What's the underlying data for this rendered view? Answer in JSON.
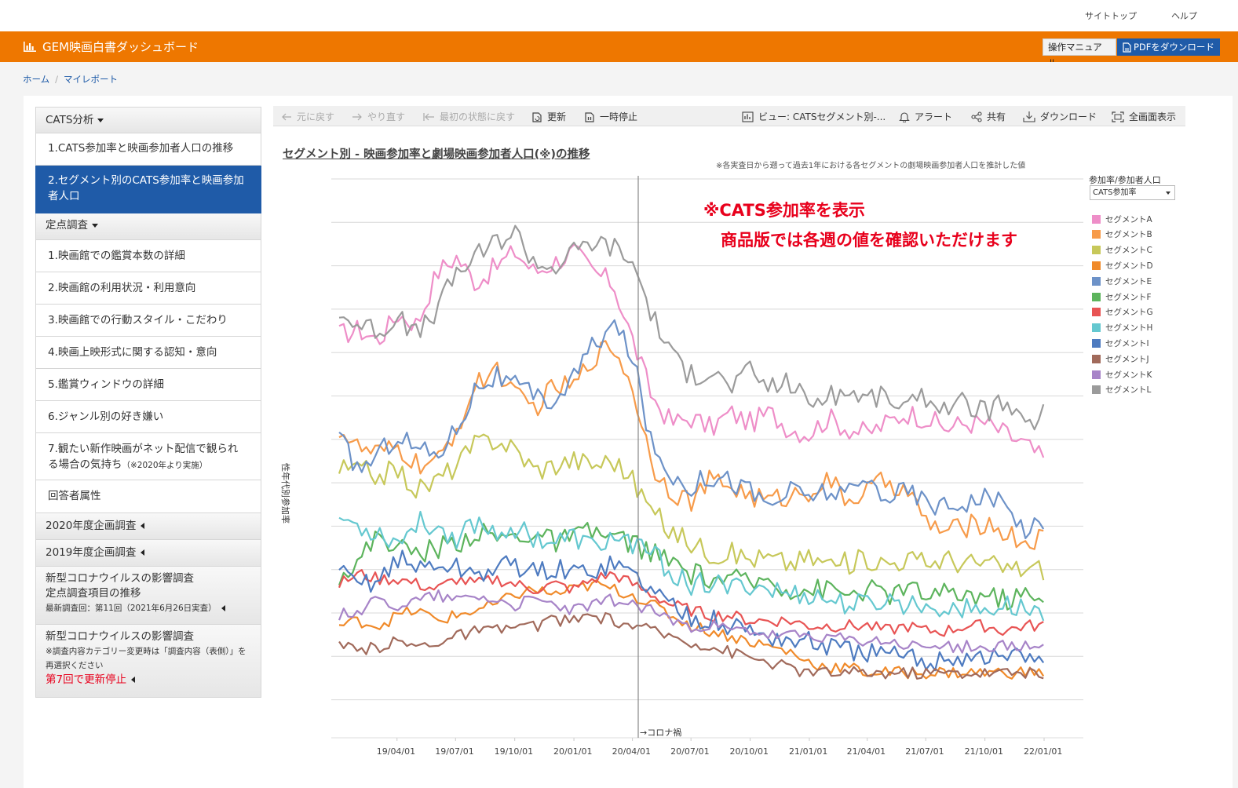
{
  "topnav": {
    "site_top": "サイトトップ",
    "help": "ヘルプ"
  },
  "header": {
    "brand_icon": "bar-chart-icon",
    "title": "GEM映画白書ダッシュボード",
    "manual_button": "操作マニュアル",
    "pdf_button": "PDFをダウンロード",
    "brand_color": "#ee7700"
  },
  "breadcrumb": [
    "ホーム",
    "マイレポート"
  ],
  "sidebar": {
    "cats_section": "CATS分析",
    "cats_items": [
      "1.CATS参加率と映画参加者人口の推移",
      "2.セグメント別のCATS参加率と映画参加者人口"
    ],
    "fixed_section": "定点調査",
    "fixed_items": [
      "1.映画館での鑑賞本数の詳細",
      "2.映画館の利用状況・利用意向",
      "3.映画館での行動スタイル・こだわり",
      "4.映画上映形式に関する認知・意向",
      "5.鑑賞ウィンドウの詳細",
      "6.ジャンル別の好き嫌い",
      "7.観たい新作映画がネット配信で観られる場合の気持ち"
    ],
    "fixed_item7_note": "（※2020年より実施）",
    "respondent_item": "回答者属性",
    "section_2020": "2020年度企画調査",
    "section_2019": "2019年度企画調査",
    "corona1_title1": "新型コロナウイルスの影響調査",
    "corona1_title2": "定点調査項目の推移",
    "corona1_note": "最新調査回：第11回（2021年6月26日実査）",
    "corona2_title": "新型コロナウイルスの影響調査",
    "corona2_note": "※調査内容カテゴリー変更時は「調査内容（表側）」を再選択ください",
    "corona2_stop": "第7回で更新停止"
  },
  "toolbar": {
    "undo": "元に戻す",
    "redo": "やり直す",
    "revert": "最初の状態に戻す",
    "refresh": "更新",
    "pause": "一時停止",
    "view": "ビュー: CATSセグメント別-...",
    "alert": "アラート",
    "share": "共有",
    "download": "ダウンロード",
    "fullscreen": "全画面表示"
  },
  "chart_title": "セグメント別 - 映画参加率と劇場映画参加者人口(※)の推移",
  "chart_note": "※各実査日から遡って過去1年における各セグメントの劇場映画参加者人口を推計した値",
  "overlay": {
    "line1": "※CATS参加率を表示",
    "line2": "商品版では各週の値を確認いただけます"
  },
  "legend": {
    "title": "参加率/参加者人口",
    "selected": "CATS参加率"
  },
  "chart_data": {
    "type": "line",
    "ylabel": "性年代別参加率",
    "x_ticks": [
      "19/04/01",
      "19/07/01",
      "19/10/01",
      "20/01/01",
      "20/04/01",
      "20/07/01",
      "20/10/01",
      "21/01/01",
      "21/04/01",
      "21/07/01",
      "21/10/01",
      "22/01/01"
    ],
    "x_start": "2019-01-01",
    "x_end": "2022-01-01",
    "reference_line": {
      "x": "2020-04-10",
      "label": "→コロナ禍"
    },
    "y_values_shown": false,
    "series": [
      {
        "name": "セグメントA",
        "color": "#ee8ec8",
        "level": [
          0.7,
          0.71,
          0.69,
          0.74,
          0.72,
          0.82,
          0.85,
          0.8,
          0.83,
          0.86,
          0.82,
          0.84,
          0.86,
          0.82,
          0.8,
          0.69,
          0.58,
          0.53,
          0.54,
          0.52,
          0.55,
          0.53,
          0.55,
          0.52,
          0.51,
          0.54,
          0.52,
          0.51,
          0.53,
          0.55,
          0.54,
          0.52,
          0.53,
          0.53,
          0.51,
          0.49,
          0.46
        ]
      },
      {
        "name": "セグメントB",
        "color": "#f79b4a",
        "level": [
          0.52,
          0.48,
          0.47,
          0.48,
          0.45,
          0.45,
          0.52,
          0.6,
          0.64,
          0.58,
          0.56,
          0.6,
          0.6,
          0.66,
          0.68,
          0.6,
          0.45,
          0.4,
          0.38,
          0.42,
          0.41,
          0.39,
          0.38,
          0.39,
          0.4,
          0.42,
          0.38,
          0.4,
          0.42,
          0.4,
          0.34,
          0.32,
          0.33,
          0.34,
          0.32,
          0.3,
          0.31
        ]
      },
      {
        "name": "セグメントC",
        "color": "#c7c85a",
        "level": [
          0.44,
          0.44,
          0.43,
          0.44,
          0.4,
          0.42,
          0.45,
          0.49,
          0.5,
          0.48,
          0.44,
          0.45,
          0.46,
          0.45,
          0.46,
          0.42,
          0.36,
          0.32,
          0.3,
          0.28,
          0.28,
          0.27,
          0.27,
          0.26,
          0.27,
          0.26,
          0.26,
          0.27,
          0.26,
          0.27,
          0.26,
          0.27,
          0.26,
          0.26,
          0.25,
          0.25,
          0.25
        ]
      },
      {
        "name": "セグメントD",
        "color": "#f08a2a",
        "level": [
          0.14,
          0.15,
          0.14,
          0.16,
          0.17,
          0.15,
          0.16,
          0.17,
          0.18,
          0.2,
          0.21,
          0.2,
          0.21,
          0.22,
          0.21,
          0.2,
          0.18,
          0.16,
          0.14,
          0.13,
          0.12,
          0.11,
          0.1,
          0.09,
          0.07,
          0.06,
          0.06,
          0.05,
          0.05,
          0.05,
          0.05,
          0.05,
          0.05,
          0.05,
          0.05,
          0.05,
          0.05
        ]
      },
      {
        "name": "セグメントE",
        "color": "#6d92c8",
        "level": [
          0.5,
          0.44,
          0.47,
          0.51,
          0.48,
          0.47,
          0.52,
          0.6,
          0.62,
          0.6,
          0.58,
          0.57,
          0.62,
          0.68,
          0.72,
          0.66,
          0.48,
          0.43,
          0.41,
          0.43,
          0.42,
          0.4,
          0.37,
          0.4,
          0.39,
          0.4,
          0.39,
          0.42,
          0.39,
          0.4,
          0.38,
          0.37,
          0.38,
          0.39,
          0.37,
          0.33,
          0.33
        ]
      },
      {
        "name": "セグメントF",
        "color": "#5db45d",
        "level": [
          0.24,
          0.26,
          0.32,
          0.29,
          0.28,
          0.29,
          0.3,
          0.32,
          0.31,
          0.31,
          0.32,
          0.3,
          0.31,
          0.32,
          0.31,
          0.3,
          0.28,
          0.26,
          0.24,
          0.23,
          0.23,
          0.22,
          0.23,
          0.21,
          0.21,
          0.21,
          0.2,
          0.21,
          0.2,
          0.21,
          0.2,
          0.2,
          0.2,
          0.2,
          0.19,
          0.2,
          0.18
        ]
      },
      {
        "name": "セグメントG",
        "color": "#e85454",
        "level": [
          0.22,
          0.24,
          0.23,
          0.23,
          0.22,
          0.21,
          0.23,
          0.22,
          0.23,
          0.22,
          0.21,
          0.22,
          0.21,
          0.23,
          0.24,
          0.22,
          0.2,
          0.18,
          0.17,
          0.16,
          0.16,
          0.15,
          0.15,
          0.15,
          0.14,
          0.14,
          0.14,
          0.14,
          0.13,
          0.14,
          0.13,
          0.13,
          0.14,
          0.14,
          0.13,
          0.14,
          0.14
        ]
      },
      {
        "name": "セグメントH",
        "color": "#65c8d0",
        "level": [
          0.35,
          0.33,
          0.32,
          0.3,
          0.34,
          0.33,
          0.31,
          0.34,
          0.32,
          0.33,
          0.31,
          0.3,
          0.31,
          0.29,
          0.31,
          0.3,
          0.28,
          0.24,
          0.22,
          0.22,
          0.21,
          0.22,
          0.21,
          0.2,
          0.2,
          0.19,
          0.18,
          0.18,
          0.19,
          0.18,
          0.18,
          0.18,
          0.17,
          0.17,
          0.18,
          0.17,
          0.17
        ]
      },
      {
        "name": "セグメントI",
        "color": "#4e7bc0",
        "level": [
          0.24,
          0.22,
          0.23,
          0.27,
          0.25,
          0.26,
          0.25,
          0.24,
          0.25,
          0.26,
          0.24,
          0.25,
          0.24,
          0.25,
          0.26,
          0.24,
          0.21,
          0.18,
          0.16,
          0.15,
          0.14,
          0.13,
          0.12,
          0.11,
          0.11,
          0.1,
          0.09,
          0.09,
          0.08,
          0.08,
          0.07,
          0.08,
          0.08,
          0.08,
          0.08,
          0.08,
          0.08
        ]
      },
      {
        "name": "セグメントJ",
        "color": "#a16a5b",
        "level": [
          0.1,
          0.09,
          0.1,
          0.11,
          0.1,
          0.11,
          0.12,
          0.13,
          0.13,
          0.14,
          0.14,
          0.15,
          0.15,
          0.16,
          0.15,
          0.14,
          0.13,
          0.12,
          0.11,
          0.1,
          0.09,
          0.08,
          0.07,
          0.06,
          0.05,
          0.05,
          0.05,
          0.05,
          0.05,
          0.05,
          0.05,
          0.05,
          0.05,
          0.05,
          0.05,
          0.05,
          0.04
        ]
      },
      {
        "name": "セグメントK",
        "color": "#a784c8",
        "level": [
          0.16,
          0.17,
          0.19,
          0.18,
          0.19,
          0.2,
          0.19,
          0.2,
          0.19,
          0.18,
          0.19,
          0.18,
          0.17,
          0.18,
          0.19,
          0.18,
          0.17,
          0.15,
          0.14,
          0.14,
          0.13,
          0.13,
          0.12,
          0.12,
          0.12,
          0.12,
          0.11,
          0.11,
          0.11,
          0.1,
          0.1,
          0.1,
          0.1,
          0.1,
          0.1,
          0.1,
          0.1
        ]
      },
      {
        "name": "セグメントL",
        "color": "#9b9b9b",
        "level": [
          0.74,
          0.72,
          0.71,
          0.73,
          0.7,
          0.75,
          0.82,
          0.85,
          0.88,
          0.9,
          0.84,
          0.83,
          0.86,
          0.88,
          0.87,
          0.84,
          0.74,
          0.66,
          0.62,
          0.63,
          0.6,
          0.63,
          0.6,
          0.61,
          0.57,
          0.58,
          0.59,
          0.58,
          0.58,
          0.56,
          0.58,
          0.56,
          0.57,
          0.55,
          0.57,
          0.52,
          0.55
        ]
      }
    ]
  }
}
